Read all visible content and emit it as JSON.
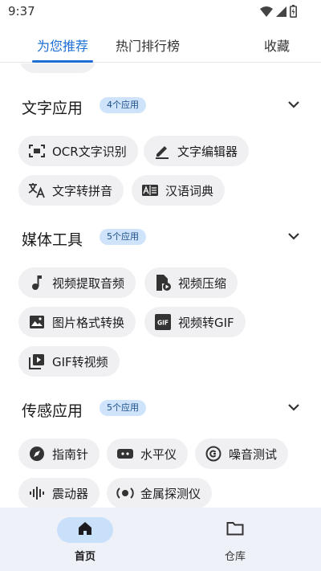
{
  "status_bar": {
    "time": "9:37",
    "icons": [
      "wifi-icon",
      "cellular-icon",
      "battery-icon"
    ]
  },
  "tabs": [
    {
      "label": "为您推荐",
      "active": true
    },
    {
      "label": "热门排行榜",
      "active": false
    },
    {
      "label": "收藏",
      "active": false
    }
  ],
  "sections": [
    {
      "title": "文字应用",
      "badge": "4个应用",
      "items": [
        {
          "label": "OCR文字识别",
          "icon": "scan-icon"
        },
        {
          "label": "文字编辑器",
          "icon": "pen-icon"
        },
        {
          "label": "文字转拼音",
          "icon": "translate-icon"
        },
        {
          "label": "汉语词典",
          "icon": "dictionary-icon"
        }
      ]
    },
    {
      "title": "媒体工具",
      "badge": "5个应用",
      "items": [
        {
          "label": "视频提取音频",
          "icon": "music-note-icon"
        },
        {
          "label": "视频压缩",
          "icon": "video-file-icon"
        },
        {
          "label": "图片格式转换",
          "icon": "image-icon"
        },
        {
          "label": "视频转GIF",
          "icon": "gif-icon"
        },
        {
          "label": "GIF转视频",
          "icon": "video-library-icon"
        }
      ]
    },
    {
      "title": "传感应用",
      "badge": "5个应用",
      "items": [
        {
          "label": "指南针",
          "icon": "compass-icon"
        },
        {
          "label": "水平仪",
          "icon": "level-icon"
        },
        {
          "label": "噪音测试",
          "icon": "noise-icon"
        },
        {
          "label": "震动器",
          "icon": "vibration-icon"
        },
        {
          "label": "金属探测仪",
          "icon": "metal-detector-icon"
        }
      ]
    }
  ],
  "bottom_nav": [
    {
      "label": "首页",
      "icon": "home-icon",
      "active": true
    },
    {
      "label": "仓库",
      "icon": "folder-icon",
      "active": false
    }
  ],
  "colors": {
    "accent": "#1d6fd6",
    "chip_bg": "#f0f0f3",
    "badge_bg": "#cfe4fb",
    "nav_bg": "#eef1f8",
    "nav_active_pill": "#c9e0fa"
  }
}
